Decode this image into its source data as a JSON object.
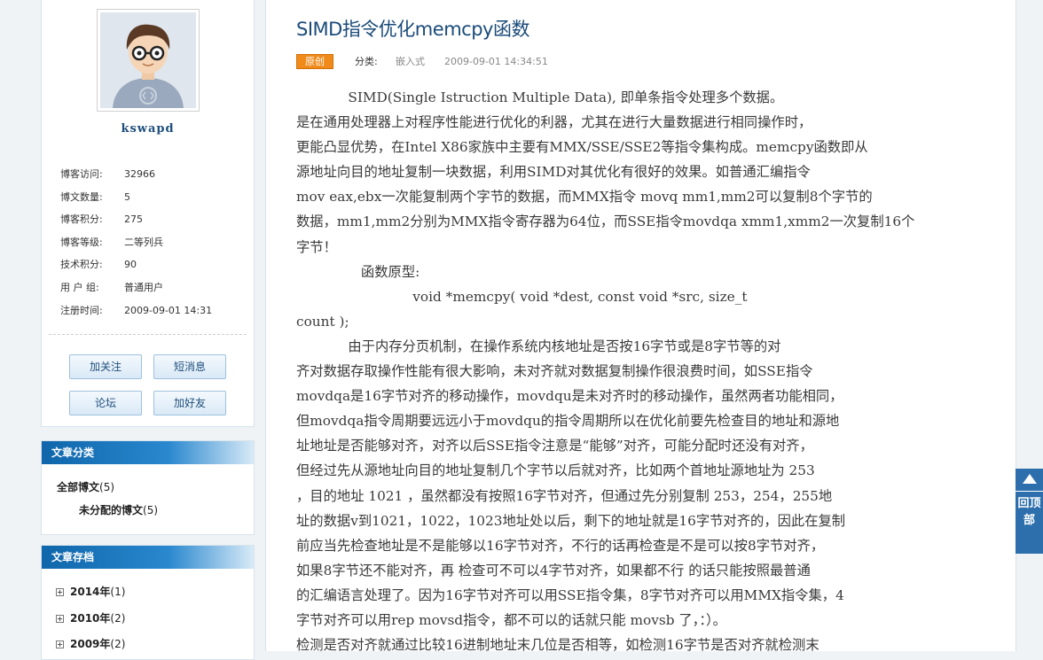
{
  "profile": {
    "username": "kswapd",
    "stats": [
      {
        "label": "博客访问:",
        "value": "32966"
      },
      {
        "label": "博文数量:",
        "value": "5"
      },
      {
        "label": "博客积分:",
        "value": "275"
      },
      {
        "label": "博客等级:",
        "value": "二等列兵"
      },
      {
        "label": "技术积分:",
        "value": "90"
      },
      {
        "label": "用 户 组:",
        "value": "普通用户"
      },
      {
        "label": "注册时间:",
        "value": "2009-09-01 14:31"
      }
    ],
    "buttons": {
      "follow": "加关注",
      "message": "短消息",
      "forum": "论坛",
      "add_friend": "加好友"
    }
  },
  "categories": {
    "title": "文章分类",
    "all": {
      "label": "全部博文",
      "count": "(5)"
    },
    "items": [
      {
        "label": "未分配的博文",
        "count": "(5)"
      }
    ]
  },
  "archive": {
    "title": "文章存档",
    "items": [
      {
        "label": "2014年",
        "count": "(1)"
      },
      {
        "label": "2010年",
        "count": "(2)"
      },
      {
        "label": "2009年",
        "count": "(2)"
      }
    ]
  },
  "article": {
    "title": "SIMD指令优化memcpy函数",
    "badge": "原创",
    "category_label": "分类:",
    "category_value": "嵌入式",
    "datetime": "2009-09-01 14:34:51",
    "lines": [
      "            SIMD(Single Istruction Multiple Data), 即单条指令处理多个数据。",
      "是在通用处理器上对程序性能进行优化的利器，尤其在进行大量数据进行相同操作时，",
      "更能凸显优势，在Intel X86家族中主要有MMX/SSE/SSE2等指令集构成。memcpy函数即从",
      "源地址向目的地址复制一块数据，利用SIMD对其优化有很好的效果。如普通汇编指令",
      "mov eax,ebx一次能复制两个字节的数据，而MMX指令 movq mm1,mm2可以复制8个字节的",
      "数据，mm1,mm2分别为MMX指令寄存器为64位，而SSE指令movdqa xmm1,xmm2一次复制16个",
      "字节！",
      "               函数原型:",
      "                           void *memcpy( void *dest, const void *src, size_t",
      "count );",
      "            由于内存分页机制，在操作系统内核地址是否按16字节或是8字节等的对",
      "齐对数据存取操作性能有很大影响，未对齐就对数据复制操作很浪费时间，如SSE指令",
      "movdqa是16字节对齐的移动操作，movdqu是未对齐时的移动操作，虽然两者功能相同，",
      "但movdqa指令周期要远远小于movdqu的指令周期所以在优化前要先检查目的地址和源地",
      "址地址是否能够对齐，对齐以后SSE指令注意是“能够”对齐，可能分配时还没有对齐，",
      "但经过先从源地址向目的地址复制几个字节以后就对齐，比如两个首地址源地址为 253",
      "，目的地址 1021 ，虽然都没有按照16字节对齐，但通过先分别复制 253，254，255地",
      "址的数据v到1021，1022，1023地址处以后，剩下的地址就是16字节对齐的，因此在复制",
      "前应当先检查地址是不是能够以16字节对齐，不行的话再检查是不是可以按8字节对齐，",
      "如果8字节还不能对齐，再 检查可不可以4字节对齐，如果都不行 的话只能按照最普通",
      "的汇编语言处理了。因为16字节对齐可以用SSE指令集，8字节对齐可以用MMX指令集，4",
      "字节对齐可以用rep movsd指令，都不可以的话就只能 movsb 了，：）。",
      "检测是否对齐就通过比较16进制地址末几位是否相等，如检测16字节是否对齐就检测末"
    ]
  },
  "back_to_top": {
    "text": "回顶部"
  }
}
